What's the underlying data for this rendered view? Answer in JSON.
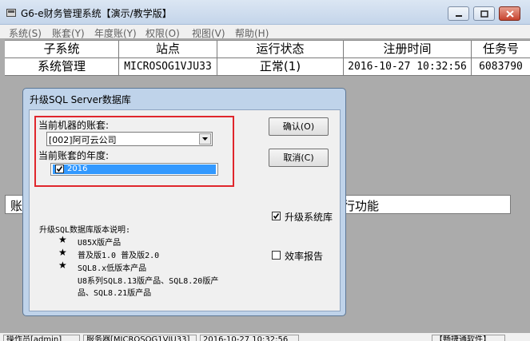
{
  "window": {
    "title": "G6-e财务管理系统【演示/教学版】"
  },
  "menu": [
    "系统(S)",
    "账套(Y)",
    "年度账(Y)",
    "权限(O)",
    "视图(V)",
    "帮助(H)"
  ],
  "grid": {
    "headers": [
      "子系统",
      "站点",
      "运行状态",
      "注册时间",
      "任务号"
    ],
    "row": [
      "系统管理",
      "MICROSOG1VJU33",
      "正常(1)",
      "2016-10-27 10:32:56",
      "6083790"
    ]
  },
  "panel2": {
    "left_text": "账",
    "right_text": "行功能"
  },
  "statusbar": [
    "操作员[admin]",
    "服务器[MICROSOG1VJU33]",
    "2016-10-27 10:32:56",
    "【畅捷通软件】"
  ],
  "dialog": {
    "title": "升级SQL Server数据库",
    "account_label": "当前机器的账套:",
    "account_value": "[002]阿可云公司",
    "year_label": "当前账套的年度:",
    "year_value": "2016",
    "year_checked": true,
    "ok_label": "确认(O)",
    "cancel_label": "取消(C)",
    "upgrade_sys_label": "升级系统库",
    "upgrade_sys_checked": true,
    "efficiency_label": "效率报告",
    "efficiency_checked": false,
    "desc_title": "升级SQL数据库版本说明:",
    "desc_items": [
      "U85X版产品",
      "普及版1.0 普及版2.0",
      "SQL8.x低版本产品"
    ],
    "desc_extra": [
      "U8系列SQL8.13版产品、SQL8.20版产",
      "品、SQL8.21版产品"
    ]
  },
  "colors": {
    "highlight_box": "#e0262c",
    "selection": "#3399ff"
  }
}
